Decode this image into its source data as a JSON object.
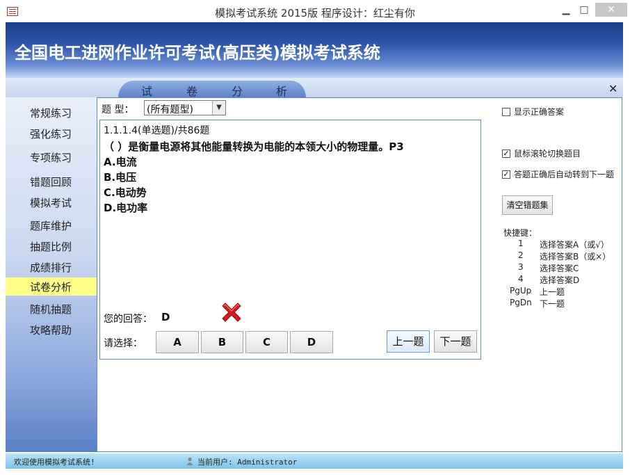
{
  "window": {
    "title": "模拟考试系统 2015版   程序设计：红尘有你",
    "minimize": "▁",
    "maximize": "□",
    "close": "✕"
  },
  "header": {
    "title": "全国电工进网作业许可考试(高压类)模拟考试系统"
  },
  "tab": {
    "chars": [
      "试",
      "卷",
      "分",
      "析"
    ],
    "close": "✕"
  },
  "sidebar": {
    "items": [
      {
        "label": "常规练习"
      },
      {
        "label": "强化练习"
      },
      {
        "label": "专项练习"
      },
      {
        "label": "错题回顾"
      },
      {
        "label": "模拟考试"
      },
      {
        "label": "题库维护"
      },
      {
        "label": "抽题比例"
      },
      {
        "label": "成绩排行"
      },
      {
        "label": "试卷分析",
        "active": true
      },
      {
        "label": "随机抽题"
      },
      {
        "label": "攻略帮助"
      }
    ]
  },
  "main": {
    "type_label": "题  型：",
    "type_value": "(所有题型)",
    "question": {
      "meta": "1.1.1.4(单选题)/共86题",
      "stem": "（  ）是衡量电源将其他能量转换为电能的本领大小的物理量。P3",
      "options": [
        "A.电流",
        "B.电压",
        "C.电动势",
        "D.电功率"
      ]
    },
    "answer_label": "您的回答：",
    "answer_value": "D",
    "choose_label": "请选择：",
    "choice_buttons": [
      "A",
      "B",
      "C",
      "D"
    ],
    "prev_button": "上一题",
    "next_button": "下一题"
  },
  "options_panel": {
    "show_correct": {
      "label": "显示正确答案",
      "checked": false
    },
    "wheel_switch": {
      "label": "鼠标滚轮切换题目",
      "checked": true
    },
    "auto_next": {
      "label": "答题正确后自动转到下一题",
      "checked": true
    },
    "clear_button": "清空错题集",
    "shortcuts_title": "快捷键：",
    "shortcuts": [
      {
        "key": "1",
        "desc": "选择答案A（或√）"
      },
      {
        "key": "2",
        "desc": "选择答案B（或×）"
      },
      {
        "key": "3",
        "desc": "选择答案C"
      },
      {
        "key": "4",
        "desc": "选择答案D"
      },
      {
        "key": "PgUp",
        "desc": "上一题"
      },
      {
        "key": "PgDn",
        "desc": "下一题"
      }
    ],
    "check_mark": "✓"
  },
  "status": {
    "welcome": "欢迎使用模拟考试系统!",
    "user": "当前用户: Administrator"
  },
  "colors": {
    "header_dark": "#1b3b86",
    "active_nav": "#ffff88",
    "border_blue": "#5b8bd6",
    "status_bar": "#7cc3ea"
  }
}
